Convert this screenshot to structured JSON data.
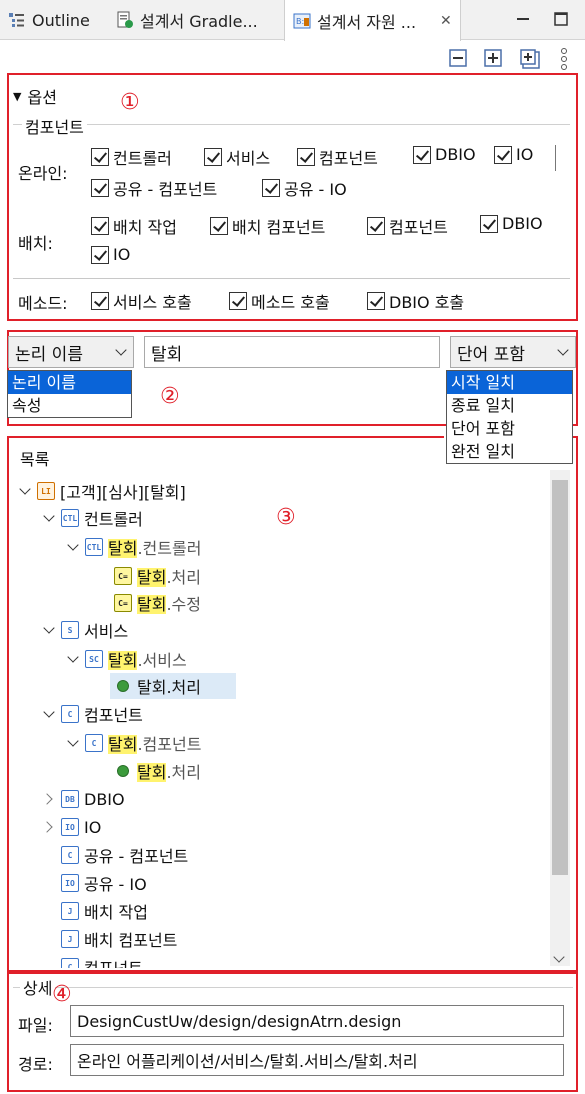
{
  "tabs": [
    {
      "label": "Outline",
      "icon": "outline-icon"
    },
    {
      "label": "설계서 Gradle...",
      "icon": "gradle-doc-icon"
    },
    {
      "label": "설계서 자원 ...",
      "icon": "design-resource-icon",
      "active": true
    }
  ],
  "window_controls": [
    "minimize-icon",
    "maximize-icon"
  ],
  "toolbar": [
    "collapse-all-icon",
    "expand-icon",
    "expand-all-icon",
    "view-menu-icon"
  ],
  "section1": {
    "number": "①",
    "options_label": "옵션",
    "group_label": "컴포넌트",
    "online_label": "온라인:",
    "online_items": [
      "컨트롤러",
      "서비스",
      "컴포넌트",
      "DBIO",
      "IO",
      "공유 - 컴포넌트",
      "공유 - IO"
    ],
    "batch_label": "배치:",
    "batch_items": [
      "배치 작업",
      "배치 컴포넌트",
      "컴포넌트",
      "DBIO",
      "IO"
    ],
    "method_label": "메소드:",
    "method_items": [
      "서비스 호출",
      "메소드 호출",
      "DBIO 호출"
    ]
  },
  "section2": {
    "number": "②",
    "field_combo": "논리 이름",
    "search_value": "탈회",
    "match_combo": "단어 포함",
    "field_options": [
      "논리 이름",
      "속성"
    ],
    "match_options": [
      "시작 일치",
      "종료 일치",
      "단어 포함",
      "완전 일치"
    ]
  },
  "section3": {
    "number": "③",
    "title": "목록",
    "root": "[고객][심사][탈회]",
    "nodes": {
      "controller": "컨트롤러",
      "controller_child_hl": "탈회",
      "controller_child_rest": ".컨트롤러",
      "ctrl_m1_hl": "탈회",
      "ctrl_m1_rest": ".처리",
      "ctrl_m2_hl": "탈회",
      "ctrl_m2_rest": ".수정",
      "service": "서비스",
      "service_child_hl": "탈회",
      "service_child_rest": ".서비스",
      "svc_m1": "탈회.처리",
      "component": "컴포넌트",
      "component_child_hl": "탈회",
      "component_child_rest": ".컴포넌트",
      "comp_m1_hl": "탈회",
      "comp_m1_rest": ".처리",
      "dbio": "DBIO",
      "io": "IO",
      "shared_component": "공유 - 컴포넌트",
      "shared_io": "공유 - IO",
      "batch_job": "배치 작업",
      "batch_component": "배치 컴포넌트",
      "last": "컴포넌트"
    }
  },
  "section4": {
    "number": "④",
    "title": "상세",
    "file_label": "파일:",
    "file_value": "DesignCustUw/design/designAtrn.design",
    "path_label": "경로:",
    "path_value": "온라인 어플리케이션/서비스/탈회.서비스/탈회.처리"
  },
  "colors": {
    "accent_red": "#e0202a",
    "selection_blue": "#0a64d8",
    "highlight_yellow": "#fff36e"
  }
}
